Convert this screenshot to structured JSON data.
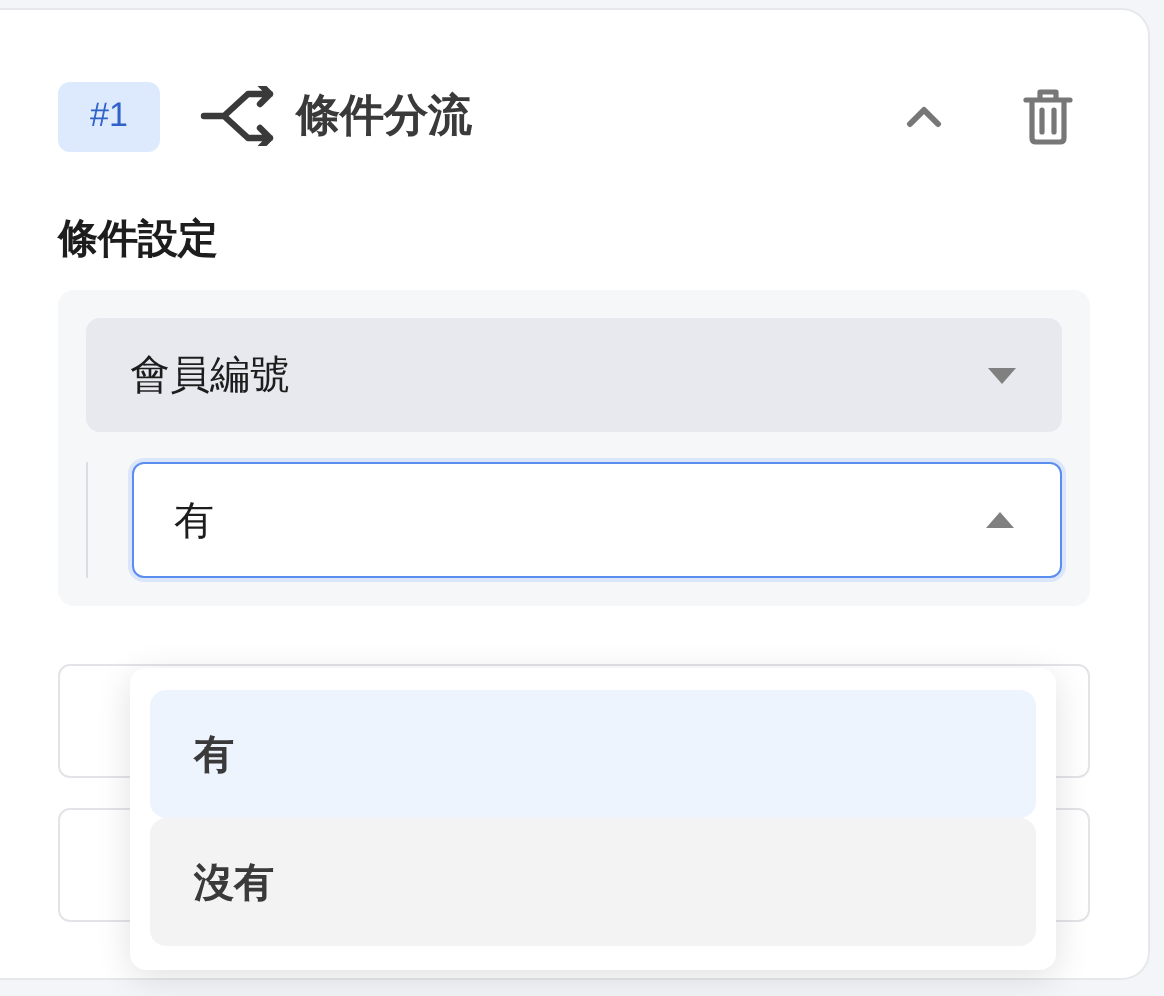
{
  "node": {
    "badge": "#1",
    "title": "條件分流",
    "expanded": true
  },
  "section_title": "條件設定",
  "condition": {
    "field": "會員編號",
    "operator_value": "有",
    "dropdown_open": true
  },
  "dropdown_options": [
    {
      "label": "有",
      "selected": true,
      "hovered": false
    },
    {
      "label": "沒有",
      "selected": false,
      "hovered": true
    }
  ]
}
